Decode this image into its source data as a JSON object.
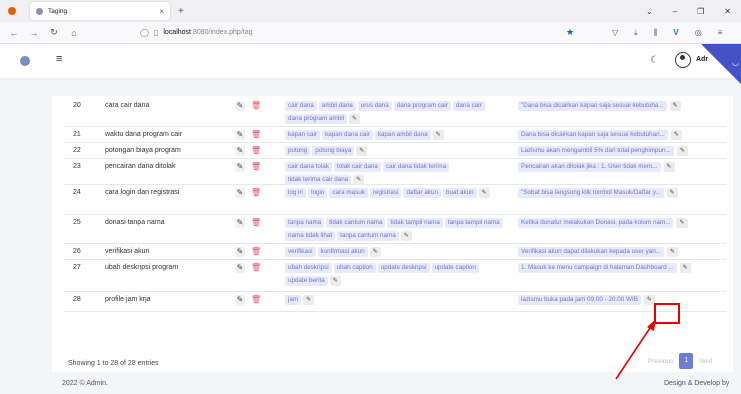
{
  "browser": {
    "tab_title": "Taging",
    "url_host": "localhost",
    "url_path": ":8080/index.php/tag"
  },
  "app": {
    "admin_label": "Adr",
    "footer_left": "2022 © Admin.",
    "footer_right": "Design & Develop by"
  },
  "table": {
    "rows": [
      {
        "no": "20",
        "question": "cara cair dana",
        "keywords": [
          "cair dana",
          "ambil dana",
          "urus dana",
          "dana program cair",
          "dana cair",
          "dana program ambil"
        ],
        "answer": "\"Dana bisa dicairkan kapan saja sesuai kebutuha..."
      },
      {
        "no": "21",
        "question": "waktu dana program cair",
        "keywords": [
          "kapan cair",
          "kapan dana cair",
          "kapan ambil dana"
        ],
        "answer": "Dana bisa dicairkan kapan saja sesuai kebutuhan..."
      },
      {
        "no": "22",
        "question": "potongan biaya program",
        "keywords": [
          "potong",
          "potong biaya"
        ],
        "answer": "Lazismu akan mengambil 5% dari total penghimpun..."
      },
      {
        "no": "23",
        "question": "pencairan dana ditolak",
        "keywords": [
          "cair dana tolak",
          "tolak cair dana",
          "cair dana tidak terima",
          "tidak terima cair dana"
        ],
        "answer": "Pencairan akan ditolak jika : 1. User tidak mem..."
      },
      {
        "no": "24",
        "question": "cara login dan registrasi",
        "keywords": [
          "log in",
          "login",
          "cara masuk",
          "registrasi",
          "daftar akun",
          "buat akun"
        ],
        "answer": "\"Sobat bisa langsung klik tombol Masuk/Daftar y..."
      },
      {
        "no": "25",
        "question": "donasi tanpa nama",
        "keywords": [
          "tanpa nama",
          "tidak cantum nama",
          "tidak tampil nama",
          "tanpa tampil nama",
          "nama tidak lihat",
          "tanpa cantum nama"
        ],
        "answer": "Ketika donatur melakukan Donasi, pada kolom nam..."
      },
      {
        "no": "26",
        "question": "verifikasi akun",
        "keywords": [
          "verifikasi",
          "konfirmasi akun"
        ],
        "answer": "Verifikasi akun dapat dilakukan kepada user yan..."
      },
      {
        "no": "27",
        "question": "ubah deskripsi program",
        "keywords": [
          "ubah deskripsi",
          "ubah caption",
          "update deskripsi",
          "update caption",
          "update berita"
        ],
        "answer": "1. Masuk ke menu campaign di halaman Dashboard ..."
      },
      {
        "no": "28",
        "question": "profile jam krja",
        "keywords": [
          "jam"
        ],
        "answer": "lazismu buka pada jam 09.00 - 20.00 WIB"
      }
    ],
    "showing_text": "Showing 1 to 28 of 28 entries",
    "pagination": {
      "previous": "Previous",
      "current": "1",
      "next": "Next"
    }
  }
}
